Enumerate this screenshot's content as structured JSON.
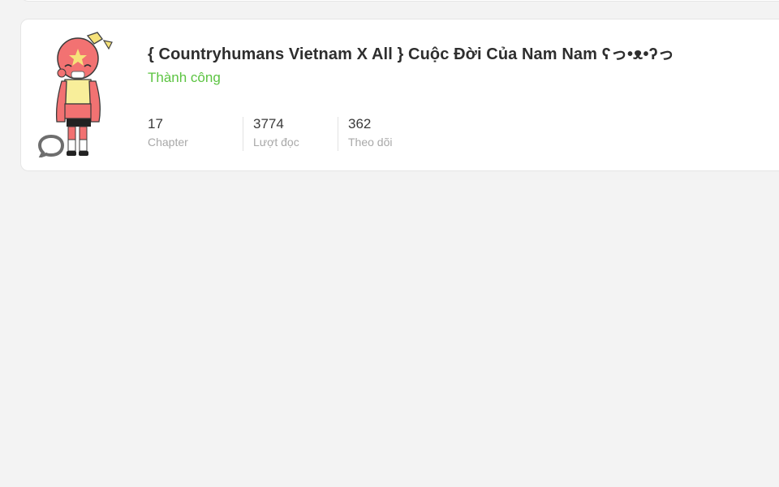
{
  "story": {
    "title": "{ Countryhumans Vietnam X All } Cuộc Đời Của Nam Nam ʕっ•ᴥ•ʔっ",
    "status": "Thành công",
    "status_color": "#5cc442",
    "cover_icon": "character-avatar",
    "comment_icon": "speech-bubble-icon",
    "stats": [
      {
        "value": "17",
        "label": "Chapter"
      },
      {
        "value": "3774",
        "label": "Lượt đọc"
      },
      {
        "value": "362",
        "label": "Theo dõi"
      }
    ]
  }
}
